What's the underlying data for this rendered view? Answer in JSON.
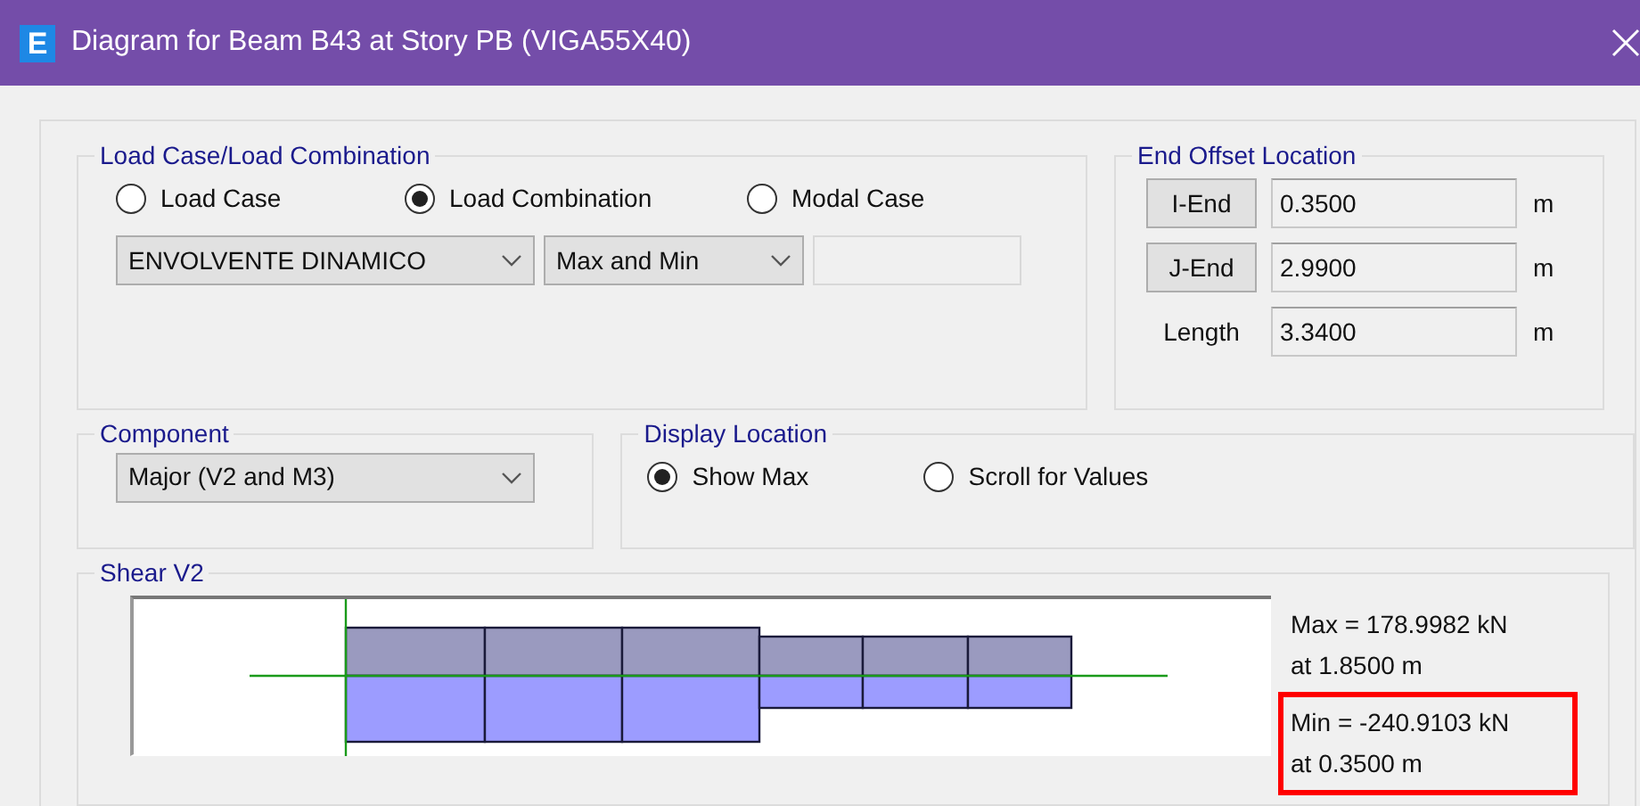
{
  "window": {
    "app_icon": "E",
    "title": "Diagram for Beam B43 at Story PB (VIGA55X40)"
  },
  "load_case": {
    "label": "Load Case/Load Combination",
    "options": [
      {
        "label": "Load Case",
        "selected": false
      },
      {
        "label": "Load Combination",
        "selected": true
      },
      {
        "label": "Modal Case",
        "selected": false
      }
    ],
    "dropdowns": [
      {
        "value": "ENVOLVENTE DINAMICO"
      },
      {
        "value": "Max and Min"
      }
    ],
    "extra_field": {
      "disabled": true
    }
  },
  "end_offset": {
    "label": "End Offset Location",
    "rows": [
      {
        "kind": "button",
        "label": "I-End",
        "value": "0.3500",
        "unit": "m"
      },
      {
        "kind": "button",
        "label": "J-End",
        "value": "2.9900",
        "unit": "m"
      },
      {
        "kind": "text",
        "label": "Length",
        "value": "3.3400",
        "unit": "m"
      }
    ]
  },
  "component": {
    "label": "Component",
    "value": "Major (V2 and M3)"
  },
  "display_location": {
    "label": "Display Location",
    "options": [
      {
        "label": "Show Max",
        "selected": true
      },
      {
        "label": "Scroll for Values",
        "selected": false
      }
    ]
  },
  "shear": {
    "label": "Shear V2",
    "results": [
      {
        "lines": [
          "Max = 178.9982 kN",
          "at 1.8500 m"
        ],
        "highlighted": false
      },
      {
        "lines": [
          "Min = -240.9103 kN",
          "at 0.3500 m"
        ],
        "highlighted": true
      }
    ]
  }
}
